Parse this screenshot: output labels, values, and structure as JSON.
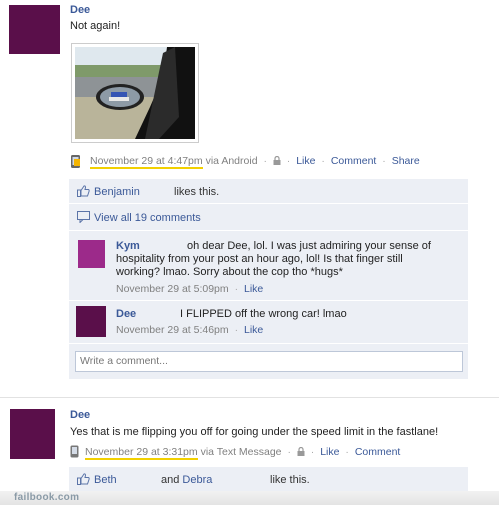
{
  "post1": {
    "author": "Dee",
    "text": "Not again!",
    "timestamp": "November 29 at 4:47pm",
    "via": "via Android",
    "like": "Like",
    "comment": "Comment",
    "share": "Share",
    "likers": "Benjamin",
    "likes_suffix": "likes this.",
    "view_all": "View all 19 comments",
    "comments": [
      {
        "author": "Kym",
        "text": "oh dear Dee, lol. I was just admiring your sense of hospitality from your post an hour ago, lol! Is that finger still working? lmao. Sorry about the cop tho *hugs*",
        "timestamp": "November 29 at 5:09pm",
        "like": "Like"
      },
      {
        "author": "Dee",
        "text": "I FLIPPED off the wrong car! lmao",
        "timestamp": "November 29 at 5:46pm",
        "like": "Like"
      }
    ],
    "write_placeholder": "Write a comment..."
  },
  "post2": {
    "author": "Dee",
    "text": "Yes that is me flipping you off for going under the speed limit in the fastlane!",
    "timestamp": "November 29 at 3:31pm",
    "via": "via Text Message",
    "like": "Like",
    "comment": "Comment",
    "liker1": "Beth",
    "and_text": "and Debra",
    "likes_suffix": "like this."
  },
  "footer": {
    "site": "failbook.com"
  },
  "colors": {
    "link": "#3b5998",
    "highlight": "#f2d000",
    "avatar": "#5a0f4a",
    "comment_bg": "#eceff5"
  }
}
